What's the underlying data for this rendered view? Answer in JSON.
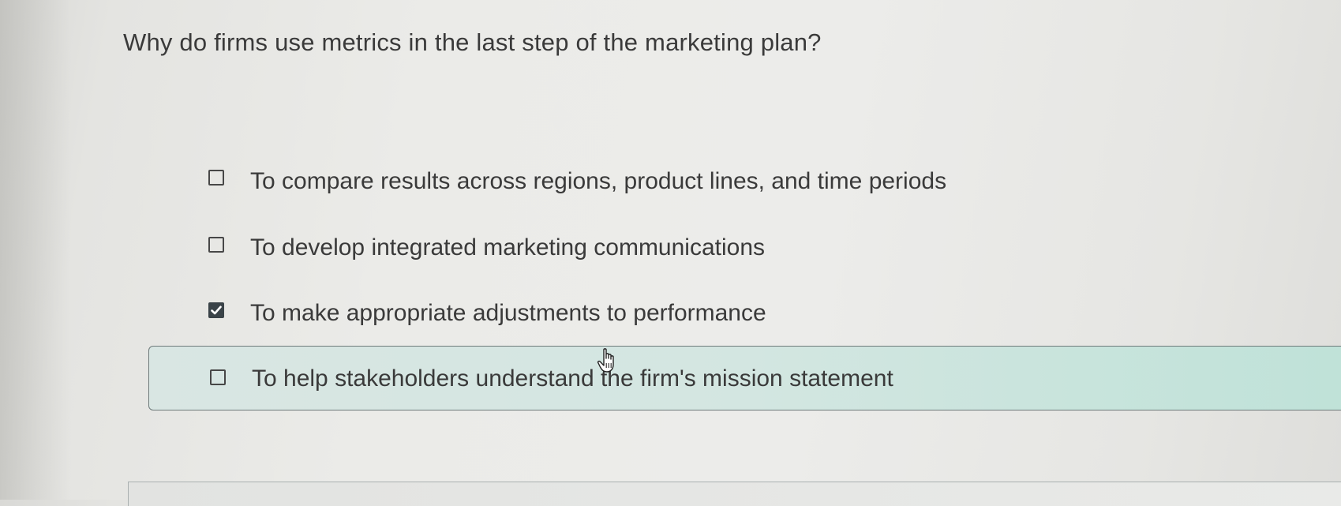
{
  "question": {
    "text": "Why do firms use metrics in the last step of the marketing plan?"
  },
  "options": [
    {
      "label": "To compare results across regions, product lines, and time periods",
      "checked": false
    },
    {
      "label": "To develop integrated marketing communications",
      "checked": false
    },
    {
      "label": "To make appropriate adjustments to performance",
      "checked": true
    },
    {
      "label": "To help stakeholders understand the firm's mission statement",
      "checked": false,
      "hovered": true
    }
  ],
  "icons": {
    "checkmark": "checkmark-icon",
    "cursor": "hand-pointer-icon"
  },
  "colors": {
    "checked_fill": "#3a4348",
    "hover_bg": "#d3e6e1",
    "text": "#3a3a3a"
  }
}
